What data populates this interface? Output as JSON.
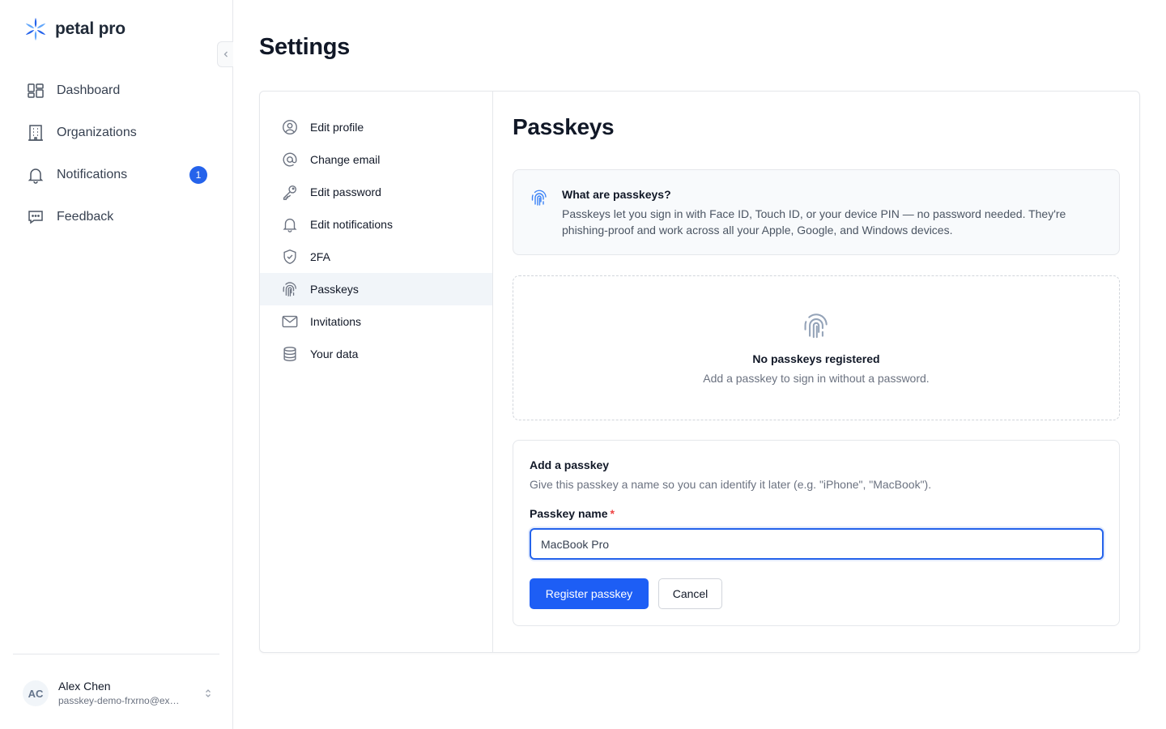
{
  "brand": {
    "name": "petal pro",
    "colors": {
      "blue": "#2563eb",
      "light_blue": "#60a5fa"
    }
  },
  "sidebar": {
    "items": [
      {
        "label": "Dashboard",
        "icon": "dashboard-icon"
      },
      {
        "label": "Organizations",
        "icon": "building-icon"
      },
      {
        "label": "Notifications",
        "icon": "bell-icon",
        "badge": "1"
      },
      {
        "label": "Feedback",
        "icon": "chat-icon"
      }
    ],
    "user": {
      "initials": "AC",
      "name": "Alex Chen",
      "email": "passkey-demo-frxrno@ex…"
    }
  },
  "page": {
    "title": "Settings"
  },
  "settings_nav": {
    "items": [
      {
        "label": "Edit profile",
        "icon": "user-circle-icon"
      },
      {
        "label": "Change email",
        "icon": "at-sign-icon"
      },
      {
        "label": "Edit password",
        "icon": "key-icon"
      },
      {
        "label": "Edit notifications",
        "icon": "bell-icon"
      },
      {
        "label": "2FA",
        "icon": "shield-check-icon"
      },
      {
        "label": "Passkeys",
        "icon": "fingerprint-icon",
        "active": true
      },
      {
        "label": "Invitations",
        "icon": "envelope-icon"
      },
      {
        "label": "Your data",
        "icon": "database-icon"
      }
    ]
  },
  "passkeys": {
    "title": "Passkeys",
    "info": {
      "title": "What are passkeys?",
      "text": "Passkeys let you sign in with Face ID, Touch ID, or your device PIN — no password needed. They're phishing-proof and work across all your Apple, Google, and Windows devices."
    },
    "empty": {
      "title": "No passkeys registered",
      "subtitle": "Add a passkey to sign in without a password."
    },
    "form": {
      "title": "Add a passkey",
      "description": "Give this passkey a name so you can identify it later (e.g. \"iPhone\", \"MacBook\").",
      "field_label": "Passkey name",
      "required_mark": "*",
      "field_value": "MacBook Pro",
      "submit_label": "Register passkey",
      "cancel_label": "Cancel"
    }
  }
}
